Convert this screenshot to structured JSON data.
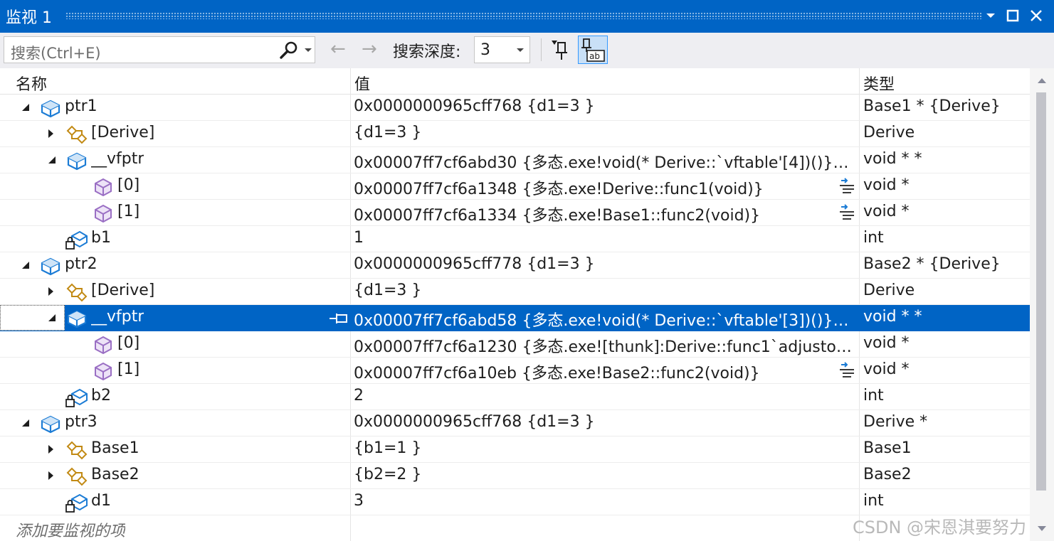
{
  "window": {
    "title": "监视 1",
    "controls": [
      "dropdown-icon",
      "maximize-icon",
      "close-icon"
    ]
  },
  "toolbar": {
    "search_placeholder": "搜索(Ctrl+E)",
    "depth_label": "搜索深度:",
    "depth_value": "3"
  },
  "columns": {
    "name": "名称",
    "value": "值",
    "type": "类型"
  },
  "rows": [
    {
      "indent": 0,
      "expander": "expanded",
      "icon": "object-icon",
      "name": "ptr1",
      "value": "0x0000000965cff768 {d1=3 }",
      "type": "Base1 * {Derive}"
    },
    {
      "indent": 1,
      "expander": "collapsed",
      "icon": "base-class-icon",
      "name": "[Derive]",
      "value": "{d1=3 }",
      "type": "Derive"
    },
    {
      "indent": 1,
      "expander": "expanded",
      "icon": "object-icon",
      "name": "__vfptr",
      "value": "0x00007ff7cf6abd30 {多态.exe!void(* Derive::`vftable'[4])()} {...",
      "type": "void * *"
    },
    {
      "indent": 2,
      "expander": "none",
      "icon": "member-icon",
      "name": "[0]",
      "value": "0x00007ff7cf6a1348 {多态.exe!Derive::func1(void)}",
      "type": "void *",
      "func": true
    },
    {
      "indent": 2,
      "expander": "none",
      "icon": "member-icon",
      "name": "[1]",
      "value": "0x00007ff7cf6a1334 {多态.exe!Base1::func2(void)}",
      "type": "void *",
      "func": true
    },
    {
      "indent": 1,
      "expander": "none",
      "icon": "private-field-icon",
      "name": "b1",
      "value": "1",
      "type": "int"
    },
    {
      "indent": 0,
      "expander": "expanded",
      "icon": "object-icon",
      "name": "ptr2",
      "value": "0x0000000965cff778 {d1=3 }",
      "type": "Base2 * {Derive}"
    },
    {
      "indent": 1,
      "expander": "collapsed",
      "icon": "base-class-icon",
      "name": "[Derive]",
      "value": "{d1=3 }",
      "type": "Derive"
    },
    {
      "indent": 1,
      "expander": "expanded",
      "icon": "object-icon",
      "name": "__vfptr",
      "value": "0x00007ff7cf6abd58 {多态.exe!void(* Derive::`vftable'[3])()} {...",
      "type": "void * *",
      "selected": true
    },
    {
      "indent": 2,
      "expander": "none",
      "icon": "member-icon",
      "name": "[0]",
      "value": "0x00007ff7cf6a1230 {多态.exe![thunk]:Derive::func1`adjustor...",
      "type": "void *"
    },
    {
      "indent": 2,
      "expander": "none",
      "icon": "member-icon",
      "name": "[1]",
      "value": "0x00007ff7cf6a10eb {多态.exe!Base2::func2(void)}",
      "type": "void *",
      "func": true
    },
    {
      "indent": 1,
      "expander": "none",
      "icon": "private-field-icon",
      "name": "b2",
      "value": "2",
      "type": "int"
    },
    {
      "indent": 0,
      "expander": "expanded",
      "icon": "object-icon",
      "name": "ptr3",
      "value": "0x0000000965cff768 {d1=3 }",
      "type": "Derive *"
    },
    {
      "indent": 1,
      "expander": "collapsed",
      "icon": "base-class-icon",
      "name": "Base1",
      "value": "{b1=1 }",
      "type": "Base1"
    },
    {
      "indent": 1,
      "expander": "collapsed",
      "icon": "base-class-icon",
      "name": "Base2",
      "value": "{b2=2 }",
      "type": "Base2"
    },
    {
      "indent": 1,
      "expander": "none",
      "icon": "private-field-icon",
      "name": "d1",
      "value": "3",
      "type": "int"
    }
  ],
  "add_item_text": "添加要监视的项",
  "watermark": "CSDN @宋恩淇要努力",
  "colors": {
    "accent": "#0064c5",
    "toolbar_bg": "#eeeef2",
    "object_icon": "#1c7cd5",
    "base_class_icon": "#c28a14",
    "member_icon": "#9a6fc4"
  }
}
